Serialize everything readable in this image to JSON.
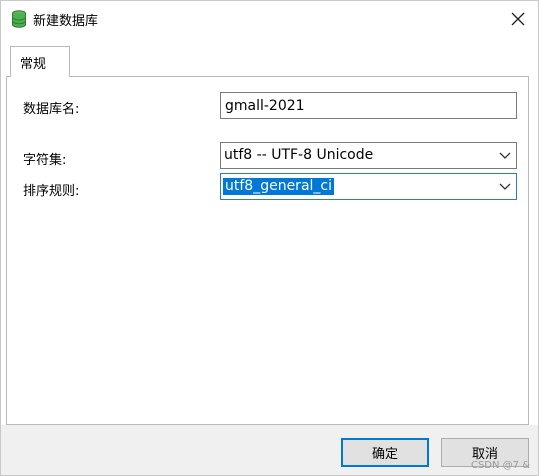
{
  "window": {
    "title": "新建数据库",
    "icon": "database-icon",
    "close_icon": "close-icon"
  },
  "tabs": [
    {
      "label": "常规",
      "active": true
    }
  ],
  "form": {
    "db_name_label": "数据库名:",
    "db_name_value": "gmall-2021",
    "charset_label": "字符集:",
    "charset_value": "utf8 -- UTF-8 Unicode",
    "collation_label": "排序规则:",
    "collation_value": "utf8_general_ci"
  },
  "buttons": {
    "ok_label": "确定",
    "cancel_label": "取消"
  },
  "watermark": "CSDN @7 &",
  "colors": {
    "accent": "#0078d7",
    "db_icon": "#4caf50",
    "footer_bg": "#f0f0f0"
  }
}
